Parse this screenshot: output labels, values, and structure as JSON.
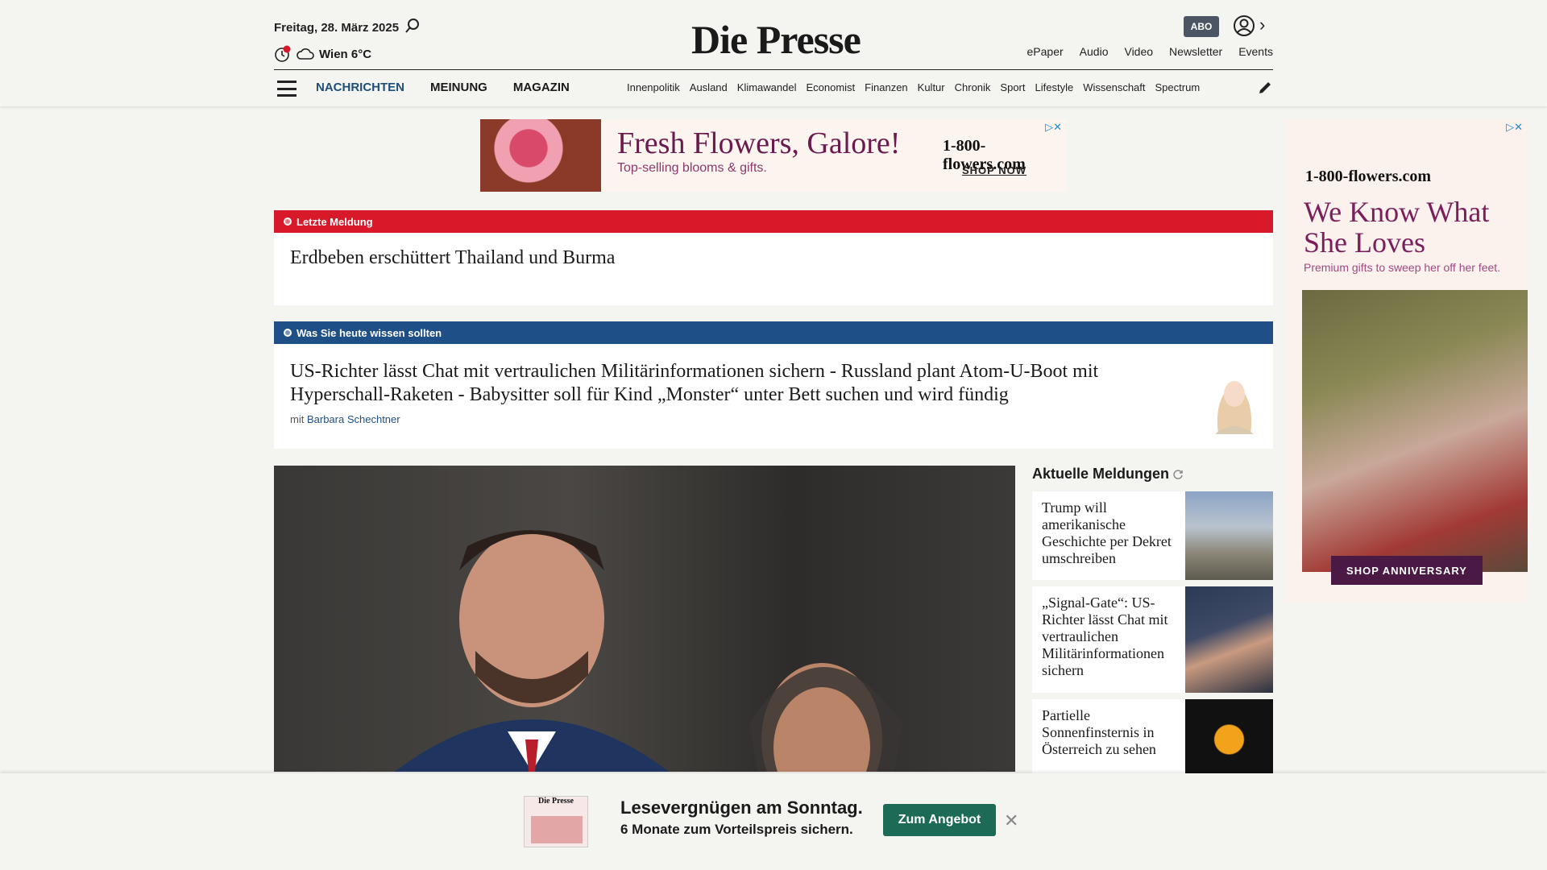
{
  "header": {
    "date": "Freitag, 28. März 2025",
    "weather": "Wien 6°C",
    "logo": "Die Presse",
    "abo": "ABO",
    "toplinks": [
      "ePaper",
      "Audio",
      "Video",
      "Newsletter",
      "Events"
    ],
    "mainnav": [
      "NACHRICHTEN",
      "MEINUNG",
      "MAGAZIN"
    ],
    "subnav": [
      "Innenpolitik",
      "Ausland",
      "Klimawandel",
      "Economist",
      "Finanzen",
      "Kultur",
      "Chronik",
      "Sport",
      "Lifestyle",
      "Wissenschaft",
      "Spectrum"
    ]
  },
  "top_ad": {
    "headline": "Fresh Flowers, Galore!",
    "subline": "Top-selling blooms & gifts.",
    "brand": "1-800-flowers.com",
    "cta": "SHOP NOW"
  },
  "breaking": {
    "label": "Letzte Meldung",
    "title": "Erdbeben erschüttert Thailand und Burma"
  },
  "briefing": {
    "label": "Was Sie heute wissen sollten",
    "title": "US-Richter lässt Chat mit vertraulichen Militärinformationen sichern - Russland plant Atom-U-Boot mit Hyperschall-Raketen - Babysitter soll für Kind „Monster“ unter Bett suchen und wird fündig",
    "author_prefix": "mit",
    "author": "Barbara Schechtner"
  },
  "aktuelle": {
    "title": "Aktuelle Meldungen",
    "items": [
      "Trump will amerikanische Geschichte per Dekret umschreiben",
      "„Signal-Gate“: US-Richter lässt Chat mit vertraulichen Militärinformationen sichern",
      "Partielle Sonnenfinsternis in Österreich zu sehen"
    ]
  },
  "side_ad": {
    "brand": "1-800-flowers.com",
    "headline": "We Know What She Loves",
    "subline": "Premium gifts to sweep her off her feet.",
    "cta": "SHOP ANNIVERSARY"
  },
  "banner": {
    "paper_label": "Die Presse",
    "line1": "Lesevergnügen am Sonntag.",
    "line2": "6 Monate zum Vorteilspreis sichern.",
    "button": "Zum Angebot"
  }
}
